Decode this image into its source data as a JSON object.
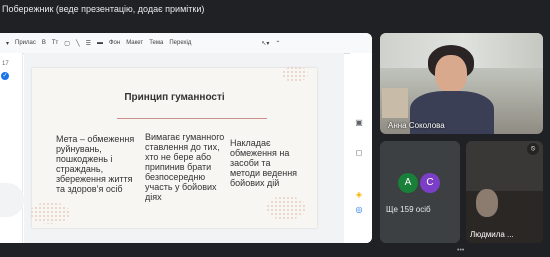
{
  "header": {
    "title": "Побережник (веде презентацію, додає примітки)"
  },
  "toolbar": {
    "items": [
      "Прилас",
      "B",
      "Tт",
      "Фон",
      "Макет",
      "Тема",
      "Перехід"
    ]
  },
  "slide_strip": {
    "number": "17"
  },
  "slide": {
    "title": "Принцип гуманності",
    "col1": "Мета – обмеження руйнувань, пошкоджень і страждань, збереження життя та здоров’я осіб",
    "col2": "Вимагає гуманного ставлення до тих, хто не бере або припинив брати безпосередню участь у бойових діях",
    "col3": "Накладає обмеження на засоби та методи ведення бойових дій"
  },
  "participants": {
    "main_name": "Анна Соколова",
    "more": {
      "avatar1": "A",
      "avatar2": "C",
      "label": "Ще 159 осіб",
      "color1": "#188038",
      "color2": "#7b3fc7"
    },
    "lyud_name": "Людмила ..."
  },
  "colors": {
    "accent_line": "#c98f8a",
    "toolbar_blue": "#1a73e8"
  }
}
